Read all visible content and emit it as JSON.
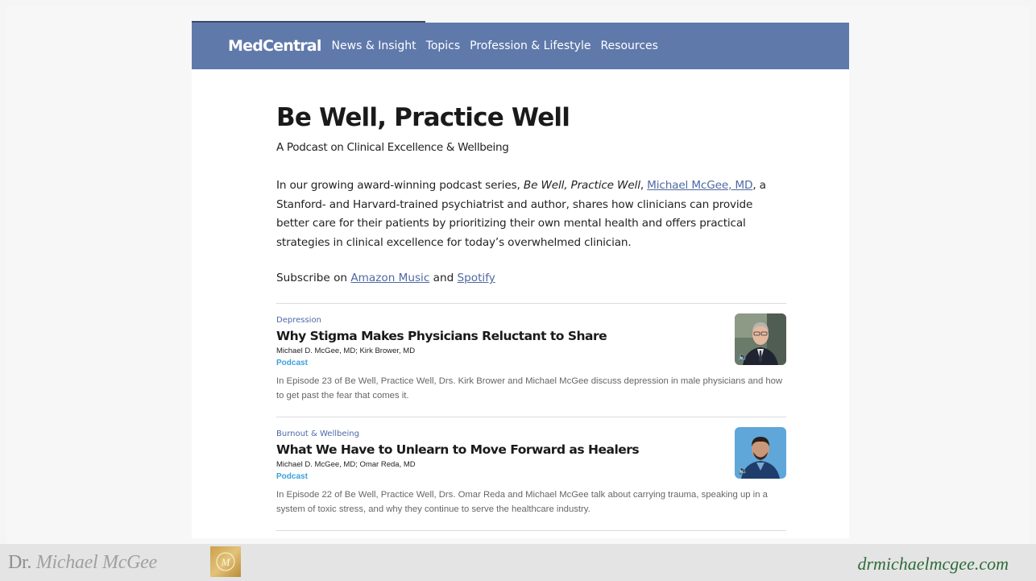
{
  "nav": {
    "brand": "MedCentral",
    "links": [
      "News & Insight",
      "Topics",
      "Profession & Lifestyle",
      "Resources"
    ]
  },
  "hero": {
    "title": "Be Well, Practice Well",
    "subtitle": "A Podcast on Clinical Excellence & Wellbeing",
    "intro_pre": "In our growing award-winning podcast series, ",
    "intro_italic": "Be Well, Practice Well",
    "intro_sep": ", ",
    "intro_link": "Michael McGee, MD",
    "intro_post": ", a Stanford- and Harvard-trained psychiatrist and author, shares how clinicians can provide better care for their patients by prioritizing their own mental health and offers practical strategies in clinical excellence for today’s overwhelmed clinician.",
    "subscribe_pre": "Subscribe on ",
    "subscribe_link1": "Amazon Music",
    "subscribe_mid": " and ",
    "subscribe_link2": "Spotify"
  },
  "articles": [
    {
      "category": "Depression",
      "title": "Why Stigma Makes Physicians Reluctant to Share",
      "authors": "Michael D. McGee, MD; Kirk Brower, MD",
      "type": "Podcast",
      "description": "In Episode 23 of Be Well, Practice Well, Drs. Kirk Brower and Michael McGee discuss depression in male physicians and how to get past the fear that comes it.",
      "thumb_icon": "speaker-icon"
    },
    {
      "category": "Burnout & Wellbeing",
      "title": "What We Have to Unlearn to Move Forward as Healers",
      "authors": "Michael D. McGee, MD; Omar Reda, MD",
      "type": "Podcast",
      "description": "In Episode 22 of Be Well, Practice Well, Drs. Omar Reda and Michael McGee talk about carrying trauma, speaking up in a system of toxic stress, and why they continue to serve the healthcare industry.",
      "thumb_icon": "speaker-icon"
    }
  ],
  "footer": {
    "name_plain": "Dr.",
    "name_script": "Michael McGee",
    "logo_letter": "M",
    "site": "drmichaelmcgee.com"
  },
  "colors": {
    "nav_bg": "#5f79ab",
    "link": "#4f69a3",
    "category": "#4b69a8",
    "podcast_tag": "#3aa0dc",
    "site_green": "#2f6b3a",
    "logo_gold": "#c9a14a"
  }
}
